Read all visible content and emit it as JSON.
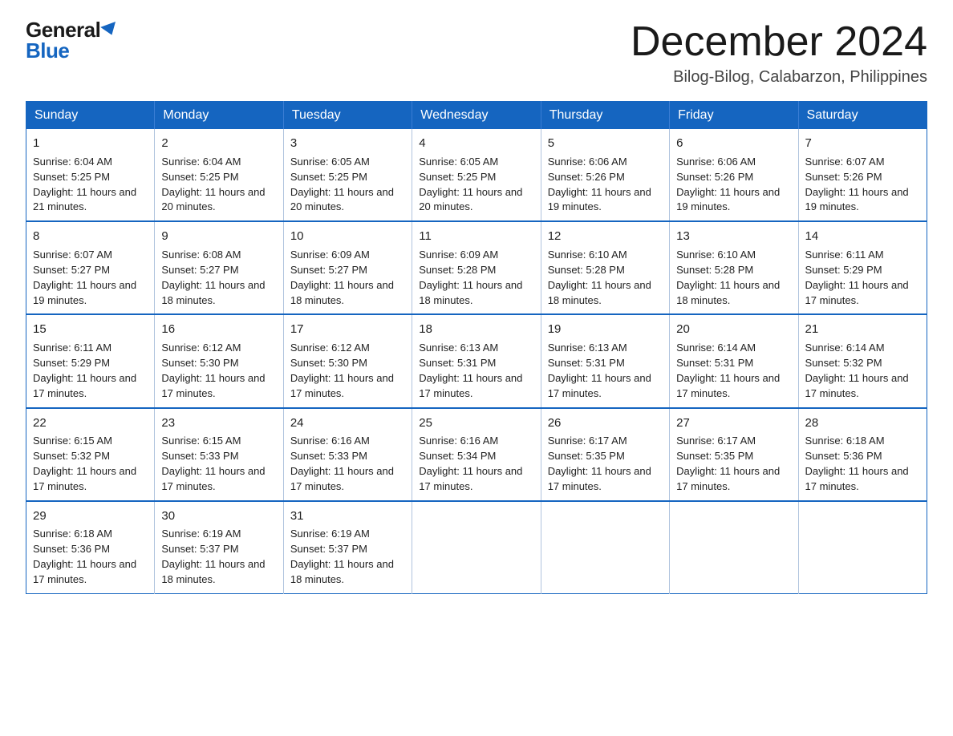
{
  "logo": {
    "general": "General",
    "blue": "Blue"
  },
  "title": {
    "month_year": "December 2024",
    "location": "Bilog-Bilog, Calabarzon, Philippines"
  },
  "headers": [
    "Sunday",
    "Monday",
    "Tuesday",
    "Wednesday",
    "Thursday",
    "Friday",
    "Saturday"
  ],
  "weeks": [
    [
      {
        "day": "1",
        "sunrise": "6:04 AM",
        "sunset": "5:25 PM",
        "daylight": "11 hours and 21 minutes."
      },
      {
        "day": "2",
        "sunrise": "6:04 AM",
        "sunset": "5:25 PM",
        "daylight": "11 hours and 20 minutes."
      },
      {
        "day": "3",
        "sunrise": "6:05 AM",
        "sunset": "5:25 PM",
        "daylight": "11 hours and 20 minutes."
      },
      {
        "day": "4",
        "sunrise": "6:05 AM",
        "sunset": "5:25 PM",
        "daylight": "11 hours and 20 minutes."
      },
      {
        "day": "5",
        "sunrise": "6:06 AM",
        "sunset": "5:26 PM",
        "daylight": "11 hours and 19 minutes."
      },
      {
        "day": "6",
        "sunrise": "6:06 AM",
        "sunset": "5:26 PM",
        "daylight": "11 hours and 19 minutes."
      },
      {
        "day": "7",
        "sunrise": "6:07 AM",
        "sunset": "5:26 PM",
        "daylight": "11 hours and 19 minutes."
      }
    ],
    [
      {
        "day": "8",
        "sunrise": "6:07 AM",
        "sunset": "5:27 PM",
        "daylight": "11 hours and 19 minutes."
      },
      {
        "day": "9",
        "sunrise": "6:08 AM",
        "sunset": "5:27 PM",
        "daylight": "11 hours and 18 minutes."
      },
      {
        "day": "10",
        "sunrise": "6:09 AM",
        "sunset": "5:27 PM",
        "daylight": "11 hours and 18 minutes."
      },
      {
        "day": "11",
        "sunrise": "6:09 AM",
        "sunset": "5:28 PM",
        "daylight": "11 hours and 18 minutes."
      },
      {
        "day": "12",
        "sunrise": "6:10 AM",
        "sunset": "5:28 PM",
        "daylight": "11 hours and 18 minutes."
      },
      {
        "day": "13",
        "sunrise": "6:10 AM",
        "sunset": "5:28 PM",
        "daylight": "11 hours and 18 minutes."
      },
      {
        "day": "14",
        "sunrise": "6:11 AM",
        "sunset": "5:29 PM",
        "daylight": "11 hours and 17 minutes."
      }
    ],
    [
      {
        "day": "15",
        "sunrise": "6:11 AM",
        "sunset": "5:29 PM",
        "daylight": "11 hours and 17 minutes."
      },
      {
        "day": "16",
        "sunrise": "6:12 AM",
        "sunset": "5:30 PM",
        "daylight": "11 hours and 17 minutes."
      },
      {
        "day": "17",
        "sunrise": "6:12 AM",
        "sunset": "5:30 PM",
        "daylight": "11 hours and 17 minutes."
      },
      {
        "day": "18",
        "sunrise": "6:13 AM",
        "sunset": "5:31 PM",
        "daylight": "11 hours and 17 minutes."
      },
      {
        "day": "19",
        "sunrise": "6:13 AM",
        "sunset": "5:31 PM",
        "daylight": "11 hours and 17 minutes."
      },
      {
        "day": "20",
        "sunrise": "6:14 AM",
        "sunset": "5:31 PM",
        "daylight": "11 hours and 17 minutes."
      },
      {
        "day": "21",
        "sunrise": "6:14 AM",
        "sunset": "5:32 PM",
        "daylight": "11 hours and 17 minutes."
      }
    ],
    [
      {
        "day": "22",
        "sunrise": "6:15 AM",
        "sunset": "5:32 PM",
        "daylight": "11 hours and 17 minutes."
      },
      {
        "day": "23",
        "sunrise": "6:15 AM",
        "sunset": "5:33 PM",
        "daylight": "11 hours and 17 minutes."
      },
      {
        "day": "24",
        "sunrise": "6:16 AM",
        "sunset": "5:33 PM",
        "daylight": "11 hours and 17 minutes."
      },
      {
        "day": "25",
        "sunrise": "6:16 AM",
        "sunset": "5:34 PM",
        "daylight": "11 hours and 17 minutes."
      },
      {
        "day": "26",
        "sunrise": "6:17 AM",
        "sunset": "5:35 PM",
        "daylight": "11 hours and 17 minutes."
      },
      {
        "day": "27",
        "sunrise": "6:17 AM",
        "sunset": "5:35 PM",
        "daylight": "11 hours and 17 minutes."
      },
      {
        "day": "28",
        "sunrise": "6:18 AM",
        "sunset": "5:36 PM",
        "daylight": "11 hours and 17 minutes."
      }
    ],
    [
      {
        "day": "29",
        "sunrise": "6:18 AM",
        "sunset": "5:36 PM",
        "daylight": "11 hours and 17 minutes."
      },
      {
        "day": "30",
        "sunrise": "6:19 AM",
        "sunset": "5:37 PM",
        "daylight": "11 hours and 18 minutes."
      },
      {
        "day": "31",
        "sunrise": "6:19 AM",
        "sunset": "5:37 PM",
        "daylight": "11 hours and 18 minutes."
      },
      null,
      null,
      null,
      null
    ]
  ]
}
